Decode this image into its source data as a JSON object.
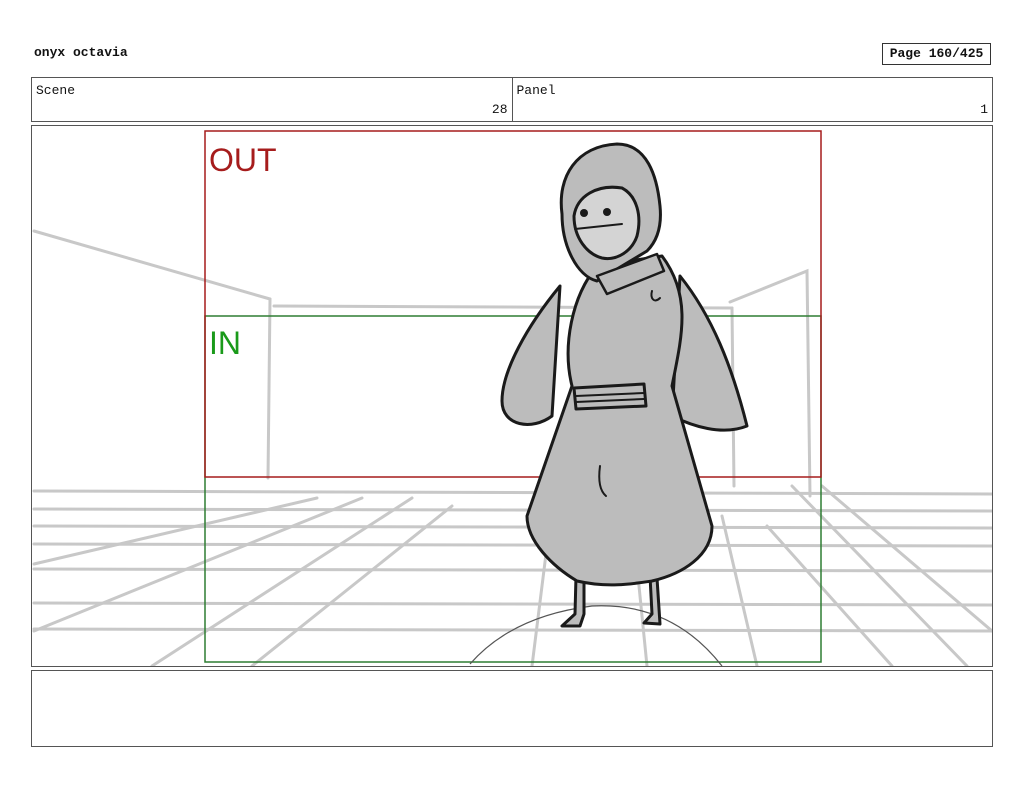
{
  "header": {
    "title": "onyx octavia",
    "page_label": "Page 160/425"
  },
  "info": {
    "scene_label": "Scene",
    "scene_value": "28",
    "panel_label": "Panel",
    "panel_value": "1"
  },
  "panel": {
    "out_label": "OUT",
    "in_label": "IN",
    "colors": {
      "out_frame": "#a61c1c",
      "in_frame": "#2e7d32",
      "sketch_lines": "#c8c8c8",
      "figure_fill": "#bcbcbc",
      "ink": "#1a1a1a"
    }
  },
  "notes": {
    "text": ""
  }
}
